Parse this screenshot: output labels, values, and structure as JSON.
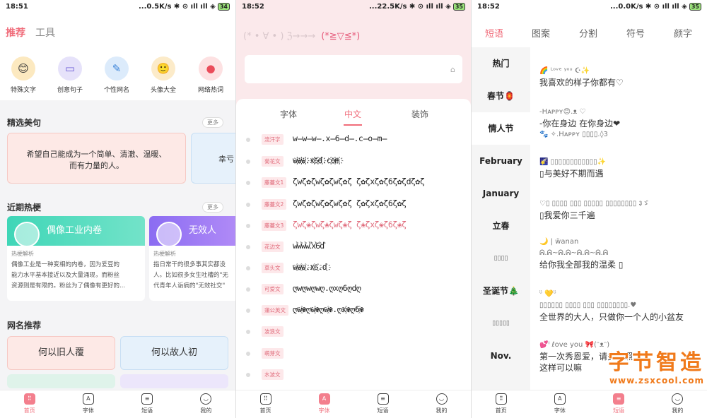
{
  "p1": {
    "status": {
      "time": "18:51",
      "right": "...0.5K/s ✱ ⊙ ıll ıll ◈",
      "battery": "34"
    },
    "tabs": [
      "推荐",
      "工具"
    ],
    "circles": [
      {
        "label": "特殊文字",
        "emoji": "😊",
        "color": "#fce9c0"
      },
      {
        "label": "创意句子",
        "emoji": "▭",
        "color": "#e6e2fa"
      },
      {
        "label": "个性网名",
        "emoji": "✎",
        "color": "#dcebfb"
      },
      {
        "label": "头像大全",
        "emoji": "🙂",
        "color": "#fcebc9"
      },
      {
        "label": "网络热词",
        "emoji": "●",
        "color": "#fde1e2"
      }
    ],
    "sec1": "精选美句",
    "more": "更多",
    "card1": "希望自己能成为一个简单、清澈、温暖、而有力量的人。",
    "card2": "幸亏",
    "sec2": "近期热梗",
    "hot": [
      {
        "title": "偶像工业内卷",
        "sub": "热梗解析",
        "text": [
          "偶像工业是一种变相的内卷，因为爱豆的",
          "能力水平基本接近以及大量涌现，而粉丝",
          "资源则是有限的。粉丝为了偶像有更好的..."
        ]
      },
      {
        "title": "无效人",
        "sub": "热梗解析",
        "text": [
          "指日常干的很多事其实都没",
          "人。比如很多女生吐槽的\"无",
          "代青年人诟病的\"无效社交\""
        ]
      }
    ],
    "sec3": "网名推荐",
    "names": [
      "何以旧人覆",
      "何以故人初"
    ],
    "tabbar": [
      {
        "label": "首页",
        "icon": "⠿"
      },
      {
        "label": "字体",
        "icon": "A"
      },
      {
        "label": "短语",
        "icon": "≡"
      },
      {
        "label": "我的",
        "icon": "◡"
      }
    ]
  },
  "p2": {
    "status": {
      "time": "18:52",
      "right": "...22.5K/s ✱ ⊙ ıll ıll ◈",
      "battery": "35"
    },
    "emoticons": "(* • ∀ • ) ℨ→→→",
    "emoticon2": "(*≧▽≦*)",
    "clear": "⌂",
    "tabs": [
      "字体",
      "中文",
      "装饰"
    ],
    "rows": [
      {
        "tag": "流汗字",
        "val": "w̶w̶w̶.x̶6̶d̶.c̶o̶m̶"
      },
      {
        "tag": "菊花文",
        "val": "w҉w҉w҉.x҉6҉d҉.c҉o҉m҉"
      },
      {
        "tag": "藤蔓文1",
        "val": "ζwζ✿ζwζ✿ζwζ✿ζ ζ✿ζxζ✿ζ6ζ✿ζdζ✿ζ"
      },
      {
        "tag": "藤蔓文2",
        "val": "ζwζ✿ζwζ✿ζwζ✿ζ ζ✿ζxζ✿ζ6ζ✿ζ"
      },
      {
        "tag": "藤蔓文3",
        "val": "ζwζ❀ζwζ❀ζwζ❀ζ ζ❀ζxζ❀ζ6ζ❀ζ"
      },
      {
        "tag": "花边文",
        "val": "wꙸwꙸwꙸwꙸ.ꙸxꙸ6ꙸdꙸ"
      },
      {
        "tag": "草头文",
        "val": "w҈w҈w҈.x҈6҈.d҈"
      },
      {
        "tag": "可爱文",
        "val": "ღwღwღwღ.ღxღ6ღdღ"
      },
      {
        "tag": "蒲公英文",
        "val": "ღw҈✾ღw҈✾ღw҈✾.ღx҈✾ღ6҈✾"
      },
      {
        "tag": "波浪文",
        "val": ""
      },
      {
        "tag": "萌芽文",
        "val": ""
      },
      {
        "tag": "水波文",
        "val": ""
      }
    ],
    "tabbar": [
      {
        "label": "首页",
        "icon": "⠿"
      },
      {
        "label": "字体",
        "icon": "A"
      },
      {
        "label": "短语",
        "icon": "≡"
      },
      {
        "label": "我的",
        "icon": "◡"
      }
    ]
  },
  "p3": {
    "status": {
      "time": "18:52",
      "right": "...0.0K/s ✱ ⊙ ıll ıll ◈",
      "battery": "35"
    },
    "tabs": [
      "短语",
      "图案",
      "分割",
      "符号",
      "颜字"
    ],
    "side": [
      "热门",
      "春节🏮",
      "情人节",
      "February",
      "January",
      "立春",
      "▯▯▯▯",
      "圣诞节🎄",
      "▯▯▯▯▯",
      "Nov."
    ],
    "quotes": [
      {
        "a": "🌈 ᴸᵒᵛᵉ ʸᵒᵘ ☪✨",
        "b": "我喜欢的样子你都有♡"
      },
      {
        "a": "-Hᴀᴘᴘʏ😊.ᴥ ♡",
        "b": "-你在身边 在你身边❤",
        "c": "🐾 ✧.Hᴀᴘᴘʏ ▯▯▯▯.◊3"
      },
      {
        "a": "🌠 ▯▯▯▯▯▯▯▯▯▯▯▯✨",
        "b": "▯与美好不期而遇"
      },
      {
        "a": "♡▯ ▯▯▯▯ ▯▯▯ ▯▯▯▯▯ ▯▯▯▯▯▯▯▯ ३ゞ",
        "b": "▯我爱你三千遍"
      },
      {
        "a": "🌙 | ẅanan",
        "b": "ᕱ.ᕱ~ᕱ.ᕱ~ᕱ.ᕱ~ᕱ.ᕱ",
        "c": "给你我全部我的温柔 ▯"
      },
      {
        "a": "ᵕ̈ 💛ᵕ̈",
        "b": "▯▯▯▯▯▯ ▯▯▯▯ ▯▯▯ ▯▯▯▯▯▯▯▯.♥",
        "c": "全世界的大人，只做你一个人的小盆友"
      },
      {
        "a": "💕ᴵ ℓove you 🎀(ᵔᴥᵔ)",
        "b": "第一次秀恩爱，请多关照",
        "c": "这样可以嘛"
      }
    ],
    "watermark": {
      "a": "字节智造",
      "b": "www.zsxcool.com"
    },
    "tabbar": [
      {
        "label": "首页",
        "icon": "⠿"
      },
      {
        "label": "字体",
        "icon": "A"
      },
      {
        "label": "短语",
        "icon": "≡"
      },
      {
        "label": "我的",
        "icon": "◡"
      }
    ]
  }
}
